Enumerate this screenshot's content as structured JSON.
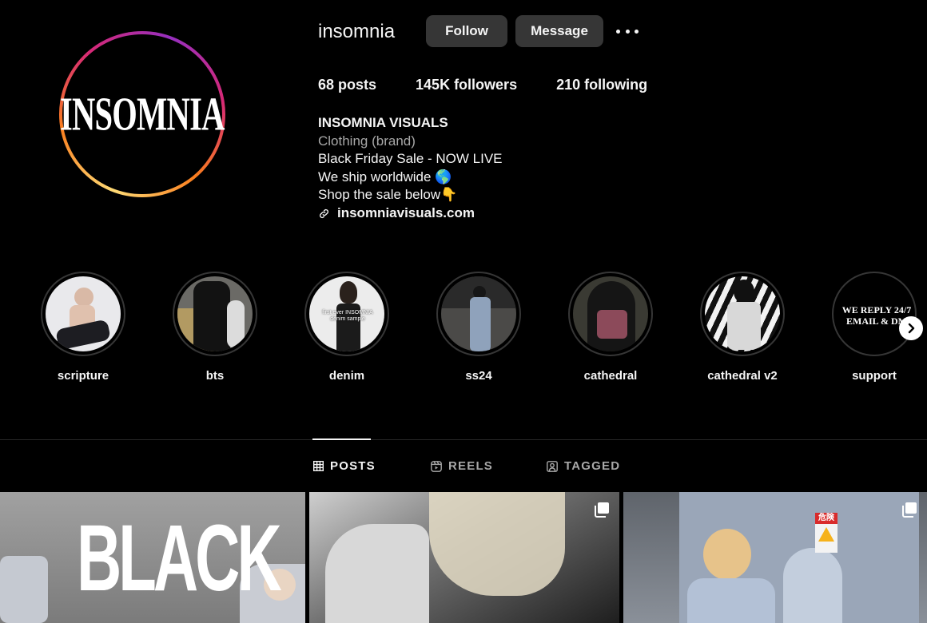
{
  "profile": {
    "username": "insomnia",
    "avatar_text": "INSOMNIA",
    "follow_label": "Follow",
    "message_label": "Message",
    "stats": {
      "posts": "68 posts",
      "followers": "145K followers",
      "following": "210 following"
    },
    "bio": {
      "name": "INSOMNIA VISUALS",
      "category": "Clothing (brand)",
      "line1": "Black Friday Sale - NOW LIVE",
      "line2": "We ship worldwide 🌎",
      "line3": "Shop the sale below👇",
      "link": "insomniavisuals.com"
    }
  },
  "highlights": [
    {
      "label": "scripture"
    },
    {
      "label": "bts"
    },
    {
      "label": "denim",
      "overlay": "first ever INSOMNIA denim sample"
    },
    {
      "label": "ss24"
    },
    {
      "label": "cathedral"
    },
    {
      "label": "cathedral v2"
    },
    {
      "label": "support",
      "overlay_line1": "WE REPLY 24/7",
      "overlay_line2": "EMAIL & DM"
    }
  ],
  "tabs": [
    {
      "label": "POSTS",
      "icon": "grid-icon",
      "active": true
    },
    {
      "label": "REELS",
      "icon": "reels-icon",
      "active": false
    },
    {
      "label": "TAGGED",
      "icon": "tagged-icon",
      "active": false
    }
  ],
  "posts": [
    {
      "overlay_text": "BLACK",
      "multi": false
    },
    {
      "multi": true
    },
    {
      "sign_text": "危険",
      "multi": true
    }
  ],
  "colors": {
    "background": "#000000",
    "button": "#363636",
    "muted_text": "#a8a8a8",
    "divider": "#262626"
  }
}
